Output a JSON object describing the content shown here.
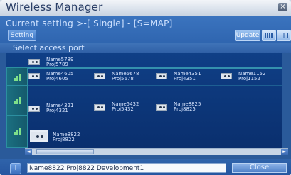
{
  "window": {
    "title": "Wireless Manager",
    "close_glyph": "×"
  },
  "header": {
    "status": "Current setting >-[ Single] - [S=MAP]",
    "setting_label": "Setting",
    "update_label": "Update",
    "view_buttons": [
      "grid-view-icon",
      "split-view-icon"
    ]
  },
  "section": {
    "label": "Select access port"
  },
  "map": {
    "signal_bands": [
      "signal-strong-icon",
      "signal-medium-icon",
      "signal-weak-icon"
    ],
    "access_points": [
      {
        "name": "Name5789",
        "proj": "Proj5789"
      },
      {
        "name": "Name4605",
        "proj": "Proj4605"
      },
      {
        "name": "Name5678",
        "proj": "Proj5678"
      },
      {
        "name": "Name4351",
        "proj": "Proj4351"
      },
      {
        "name": "Name1152",
        "proj": "Proj1152"
      },
      {
        "name": "Name4321",
        "proj": "Proj4321"
      },
      {
        "name": "Name5432",
        "proj": "Proj5432"
      },
      {
        "name": "Name8825",
        "proj": "Proj8825"
      },
      {
        "name": "Name8822",
        "proj": "Proj8822"
      }
    ]
  },
  "scrollbar": {
    "left_glyph": "◄",
    "right_glyph": "►"
  },
  "footer": {
    "info_glyph": "i",
    "selected_text": "Name8822 Proj8822 Development1",
    "close_label": "Close"
  }
}
